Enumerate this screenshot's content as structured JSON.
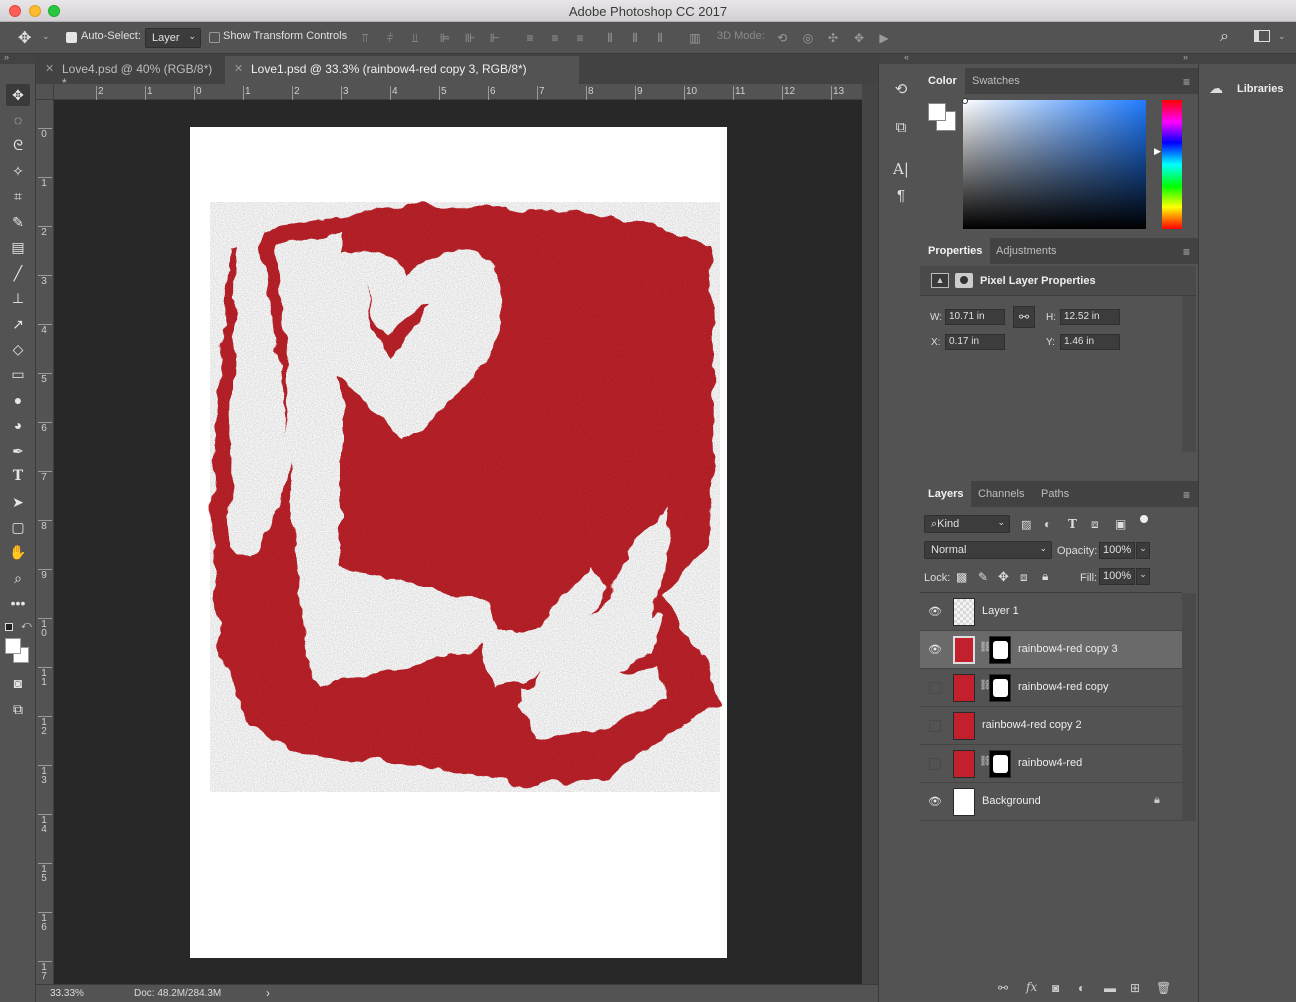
{
  "app": {
    "window_title": "Adobe Photoshop CC 2017"
  },
  "options_bar": {
    "auto_select_label": "Auto-Select:",
    "auto_select_value": "Layer",
    "show_transform_label": "Show Transform Controls",
    "mode_3d_label": "3D Mode:"
  },
  "tabs": [
    {
      "label": "Love4.psd @ 40% (RGB/8*) *",
      "active": false
    },
    {
      "label": "Love1.psd @ 33.3% (rainbow4-red copy 3, RGB/8*)",
      "active": true
    }
  ],
  "rulers": {
    "h_ticks": [
      "2",
      "1",
      "0",
      "1",
      "2",
      "3",
      "4",
      "5",
      "6",
      "7",
      "8",
      "9",
      "10",
      "11",
      "12",
      "13"
    ],
    "v_ticks": [
      "0",
      "1",
      "2",
      "3",
      "4",
      "5",
      "6",
      "7",
      "8",
      "9",
      "10",
      "11",
      "12",
      "13",
      "14",
      "15",
      "16",
      "17"
    ]
  },
  "status": {
    "zoom": "33.33%",
    "doc": "Doc: 48.2M/284.3M",
    "arrow": "›"
  },
  "color_panel": {
    "tabs": [
      "Color",
      "Swatches"
    ]
  },
  "properties_panel": {
    "tabs": [
      "Properties",
      "Adjustments"
    ],
    "header": "Pixel Layer Properties",
    "w_label": "W:",
    "w_value": "10.71 in",
    "h_label": "H:",
    "h_value": "12.52 in",
    "x_label": "X:",
    "x_value": "0.17 in",
    "y_label": "Y:",
    "y_value": "1.46 in"
  },
  "layers_panel": {
    "tabs": [
      "Layers",
      "Channels",
      "Paths"
    ],
    "filter_kind": "Kind",
    "blend_mode": "Normal",
    "opacity_label": "Opacity:",
    "opacity_value": "100%",
    "lock_label": "Lock:",
    "fill_label": "Fill:",
    "fill_value": "100%",
    "layers": [
      {
        "name": "Layer 1",
        "visible": true,
        "selected": false,
        "mask": false,
        "thumb": "transparent"
      },
      {
        "name": "rainbow4-red copy 3",
        "visible": true,
        "selected": true,
        "mask": true,
        "thumb": "red"
      },
      {
        "name": "rainbow4-red copy",
        "visible": false,
        "selected": false,
        "mask": true,
        "thumb": "red"
      },
      {
        "name": "rainbow4-red copy 2",
        "visible": false,
        "selected": false,
        "mask": false,
        "thumb": "red"
      },
      {
        "name": "rainbow4-red",
        "visible": false,
        "selected": false,
        "mask": true,
        "thumb": "red"
      },
      {
        "name": "Background",
        "visible": true,
        "selected": false,
        "mask": false,
        "thumb": "white",
        "locked": true
      }
    ]
  },
  "libraries": {
    "label": "Libraries"
  },
  "colors": {
    "paint_red": "#c1202c",
    "panel_bg": "#535353",
    "canvas_bg": "#282828"
  }
}
